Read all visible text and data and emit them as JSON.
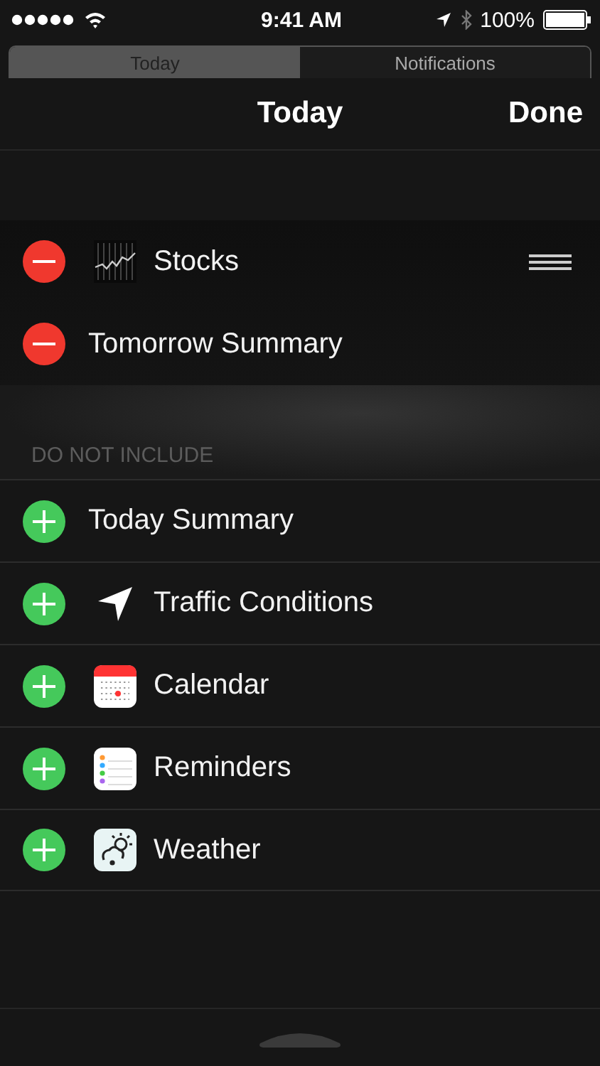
{
  "status_bar": {
    "time": "9:41 AM",
    "battery": "100%"
  },
  "tabs": [
    {
      "label": "Today",
      "selected": true
    },
    {
      "label": "Notifications",
      "selected": false
    }
  ],
  "header": {
    "title": "Today",
    "done": "Done"
  },
  "included": [
    {
      "label": "Stocks",
      "kind": "stocks",
      "reorder_handle": true
    },
    {
      "label": "Tomorrow Summary",
      "kind": "plain",
      "reorder_handle": false
    }
  ],
  "section_header": "DO NOT INCLUDE",
  "excluded": [
    {
      "label": "Today Summary",
      "kind": "plain"
    },
    {
      "label": "Traffic Conditions",
      "kind": "location"
    },
    {
      "label": "Calendar",
      "kind": "calendar"
    },
    {
      "label": "Reminders",
      "kind": "reminders"
    },
    {
      "label": "Weather",
      "kind": "weather"
    }
  ]
}
